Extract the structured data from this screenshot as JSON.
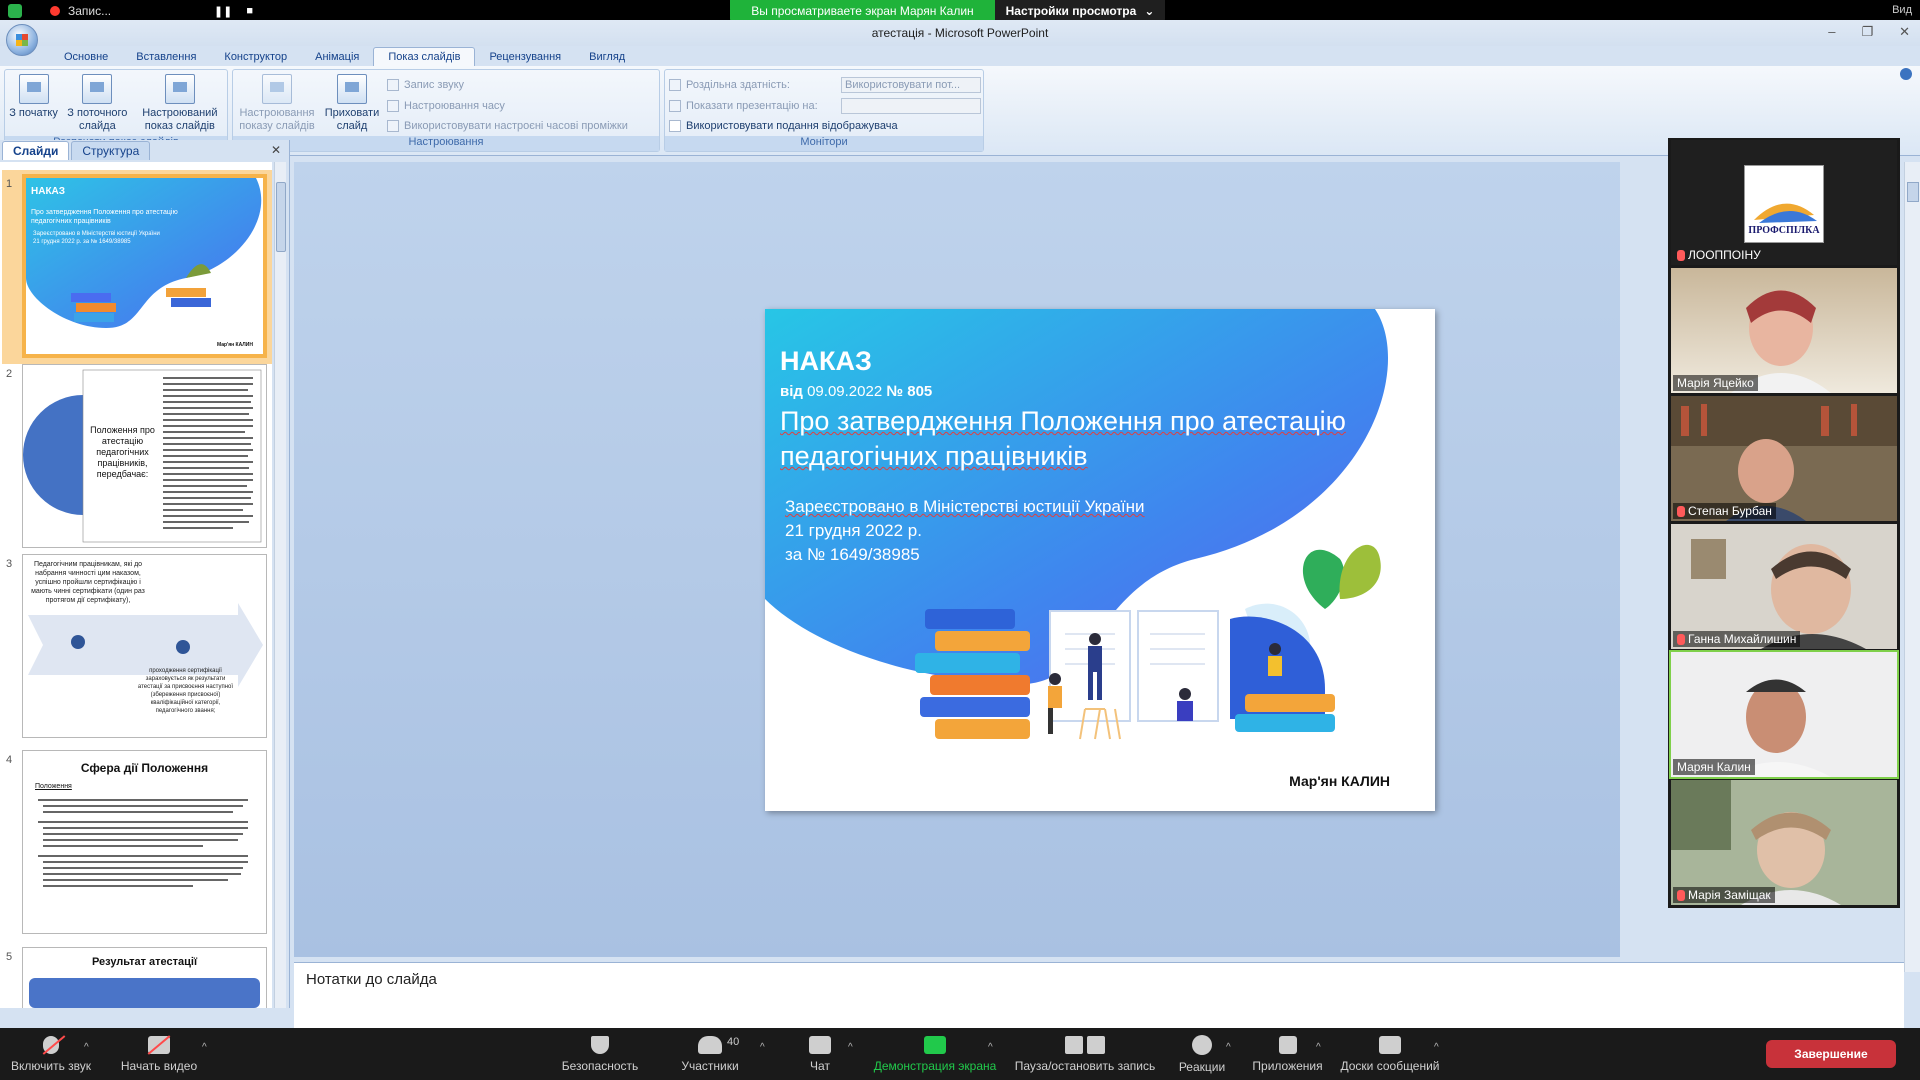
{
  "zoom": {
    "recording_label": "Запис...",
    "share_banner": "Вы просматриваете экран Марян Калин",
    "view_options": "Настройки просмотра",
    "view_label": "Вид",
    "toolbar": {
      "mute": "Включить звук",
      "video": "Начать видео",
      "security": "Безопасность",
      "participants": "Участники",
      "participants_count": "40",
      "chat": "Чат",
      "share": "Демонстрация экрана",
      "record": "Пауза/остановить запись",
      "reactions": "Реакции",
      "apps": "Приложения",
      "whiteboards": "Доски сообщений",
      "end": "Завершение"
    },
    "participants": [
      {
        "name": "ЛООППОІНУ",
        "logo": "ПРОФСПІЛКА"
      },
      {
        "name": "Марія Яцейко"
      },
      {
        "name": "Степан Бурбан"
      },
      {
        "name": "Ганна Михайлишин"
      },
      {
        "name": "Марян Калин",
        "active": true
      },
      {
        "name": "Марія Заміщак"
      }
    ]
  },
  "ppt": {
    "window_title": "атестація - Microsoft PowerPoint",
    "tabs": [
      "Основне",
      "Вставлення",
      "Конструктор",
      "Анімація",
      "Показ слайдів",
      "Рецензування",
      "Вигляд"
    ],
    "active_tab": "Показ слайдів",
    "groups": {
      "start": {
        "label": "Розпочати показ слайдів",
        "from_start": "З початку",
        "from_current": "З поточного слайда",
        "custom": "Настроюваний показ слайдів"
      },
      "setup": {
        "label": "Настроювання",
        "setup_show": "Настроювання показу слайдів",
        "hide_slide": "Приховати слайд",
        "record_audio": "Запис звуку",
        "rehearse": "Настроювання часу",
        "use_timings": "Використовувати настроєні часові проміжки"
      },
      "monitors": {
        "label": "Монітори",
        "resolution_label": "Роздільна здатність:",
        "resolution_value": "Використовувати пот...",
        "show_on_label": "Показати презентацію на:",
        "presenter_view": "Використовувати подання відображувача"
      }
    },
    "panel_tabs": [
      "Слайди",
      "Структура"
    ],
    "thumbnails": [
      {
        "num": "1",
        "title": "НАКАЗ",
        "subtitle": "Про затвердження Положення про атестацію педагогічних працівників",
        "body": "Зареєстровано в Міністерстві юстиції України 21 грудня 2022 р. за № 1649/38985",
        "author": "Мар'ян КАЛИН"
      },
      {
        "num": "2",
        "title": "Положення про атестацію педагогічних працівників, передбачає:"
      },
      {
        "num": "3",
        "title": "Педагогічним працівникам, які до набрання чинності цим наказом, успішно пройшли сертифікацію і мають чинні сертифікати (один раз протягом дії сертифікату),",
        "body": "проходження сертифікації зараховується як результати атестації за присвоєння наступної (збереження присвоєної) кваліфікаційної категорії, педагогічного звання;"
      },
      {
        "num": "4",
        "title": "Сфера дії Положення",
        "body": "Положення"
      },
      {
        "num": "5",
        "title": "Результат атестації"
      }
    ],
    "slide": {
      "title": "НАКАЗ",
      "date_prefix": "від",
      "date": "09.09.2022",
      "number": "№ 805",
      "heading": "Про затвердження Положення про атестацію педагогічних працівників",
      "reg_line1": "Зареєстровано в Міністерстві юстиції України",
      "reg_line2": "21 грудня 2022 р.",
      "reg_line3": "за № 1649/38985",
      "author": "Мар'ян КАЛИН"
    },
    "notes_placeholder": "Нотатки до слайда"
  }
}
